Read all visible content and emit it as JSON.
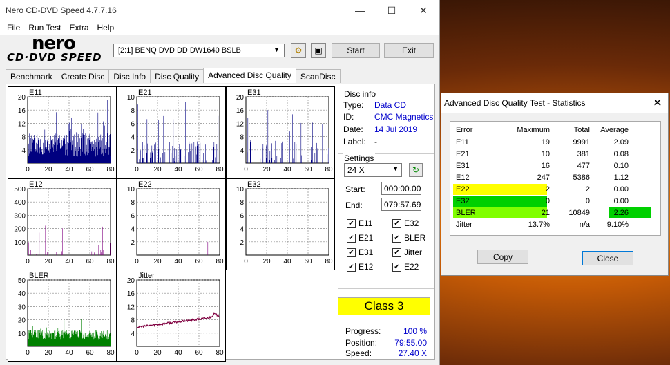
{
  "window": {
    "title": "Nero CD-DVD Speed 4.7.7.16",
    "min": "—",
    "max": "☐",
    "close": "✕"
  },
  "menu": [
    "File",
    "Run Test",
    "Extra",
    "Help"
  ],
  "logo": {
    "top": "nero",
    "bottom": "CD·DVD SPEED"
  },
  "drive": {
    "value": "[2:1]   BENQ DVD DD DW1640 BSLB"
  },
  "buttons": {
    "start": "Start",
    "exit": "Exit"
  },
  "tabs": [
    "Benchmark",
    "Create Disc",
    "Disc Info",
    "Disc Quality",
    "Advanced Disc Quality",
    "ScanDisc"
  ],
  "active_tab": "Advanced Disc Quality",
  "disc_info": {
    "header": "Disc info",
    "type_label": "Type:",
    "type": "Data CD",
    "id_label": "ID:",
    "id": "CMC Magnetics",
    "date_label": "Date:",
    "date": "14 Jul 2019",
    "label_label": "Label:",
    "label": "-"
  },
  "settings": {
    "header": "Settings",
    "speed": "24 X",
    "start_label": "Start:",
    "start": "000:00.00",
    "end_label": "End:",
    "end": "079:57.69"
  },
  "checks": [
    {
      "label": "E11",
      "checked": true
    },
    {
      "label": "E32",
      "checked": true
    },
    {
      "label": "E21",
      "checked": true
    },
    {
      "label": "BLER",
      "checked": true
    },
    {
      "label": "E31",
      "checked": true
    },
    {
      "label": "Jitter",
      "checked": true
    },
    {
      "label": "E12",
      "checked": true
    },
    {
      "label": "E22",
      "checked": true
    }
  ],
  "class_label": "Class 3",
  "progress": {
    "progress_label": "Progress:",
    "progress": "100 %",
    "position_label": "Position:",
    "position": "79:55.00",
    "speed_label": "Speed:",
    "speed": "27.40 X"
  },
  "colors": {
    "bar_blue": "#000080",
    "bar_purple": "#800080",
    "bar_green": "#008000",
    "jitter": "#800040",
    "yellow": "#ffff00",
    "green": "#00d000",
    "lime": "#80ff00"
  },
  "chart_data": [
    {
      "type": "bar",
      "title": "E11",
      "x_ticks": [
        "0",
        "20",
        "40",
        "60",
        "80"
      ],
      "y_ticks": [
        "20",
        "16",
        "12",
        "8",
        "4"
      ],
      "ylim": [
        0,
        20
      ]
    },
    {
      "type": "bar",
      "title": "E21",
      "x_ticks": [
        "0",
        "20",
        "40",
        "60",
        "80"
      ],
      "y_ticks": [
        "10",
        "8",
        "6",
        "4",
        "2"
      ],
      "ylim": [
        0,
        10
      ]
    },
    {
      "type": "bar",
      "title": "E31",
      "x_ticks": [
        "0",
        "20",
        "40",
        "60",
        "80"
      ],
      "y_ticks": [
        "20",
        "16",
        "12",
        "8",
        "4"
      ],
      "ylim": [
        0,
        20
      ]
    },
    {
      "type": "bar",
      "title": "E12",
      "x_ticks": [
        "0",
        "20",
        "40",
        "60",
        "80"
      ],
      "y_ticks": [
        "500",
        "400",
        "300",
        "200",
        "100"
      ],
      "ylim": [
        0,
        500
      ]
    },
    {
      "type": "bar",
      "title": "E22",
      "x_ticks": [
        "0",
        "20",
        "40",
        "60",
        "80"
      ],
      "y_ticks": [
        "10",
        "8",
        "6",
        "4",
        "2"
      ],
      "ylim": [
        0,
        10
      ]
    },
    {
      "type": "bar",
      "title": "E32",
      "x_ticks": [
        "0",
        "20",
        "40",
        "60",
        "80"
      ],
      "y_ticks": [
        "10",
        "8",
        "6",
        "4",
        "2"
      ],
      "ylim": [
        0,
        10
      ]
    },
    {
      "type": "bar",
      "title": "BLER",
      "x_ticks": [
        "0",
        "20",
        "40",
        "60",
        "80"
      ],
      "y_ticks": [
        "50",
        "40",
        "30",
        "20",
        "10"
      ],
      "ylim": [
        0,
        50
      ]
    },
    {
      "type": "line",
      "title": "Jitter",
      "x_ticks": [
        "0",
        "20",
        "40",
        "60",
        "80"
      ],
      "y_ticks": [
        "20",
        "16",
        "12",
        "8",
        "4"
      ],
      "ylim": [
        0,
        20
      ]
    }
  ],
  "stats": {
    "title": "Advanced Disc Quality Test - Statistics",
    "headers": [
      "Error",
      "Maximum",
      "Total",
      "Average"
    ],
    "rows": [
      {
        "error": "E11",
        "max": "19",
        "total": "9991",
        "avg": "2.09"
      },
      {
        "error": "E21",
        "max": "10",
        "total": "381",
        "avg": "0.08"
      },
      {
        "error": "E31",
        "max": "16",
        "total": "477",
        "avg": "0.10"
      },
      {
        "error": "E12",
        "max": "247",
        "total": "5386",
        "avg": "1.12"
      },
      {
        "error": "E22",
        "max": "2",
        "total": "2",
        "avg": "0.00"
      },
      {
        "error": "E32",
        "max": "0",
        "total": "0",
        "avg": "0.00"
      },
      {
        "error": "BLER",
        "max": "21",
        "total": "10849",
        "avg": "2.26"
      },
      {
        "error": "Jitter",
        "max": "13.7%",
        "total": "n/a",
        "avg": "9.10%"
      }
    ],
    "copy": "Copy",
    "close": "Close"
  }
}
